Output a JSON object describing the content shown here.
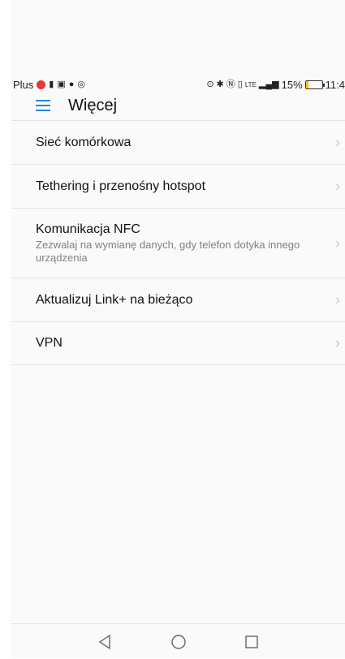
{
  "status_bar": {
    "carrier": "Plus",
    "battery_percent": "15%",
    "battery_level": 0.15,
    "time": "11:4",
    "signal_label": "LTE"
  },
  "header": {
    "title": "Więcej"
  },
  "items": [
    {
      "label": "Sieć komórkowa",
      "sub": ""
    },
    {
      "label": "Tethering i przenośny hotspot",
      "sub": ""
    },
    {
      "label": "Komunikacja NFC",
      "sub": "Zezwalaj na wymianę danych, gdy telefon dotyka innego urządzenia"
    },
    {
      "label": "Aktualizuj Link+ na bieżąco",
      "sub": ""
    },
    {
      "label": "VPN",
      "sub": ""
    }
  ],
  "icons": {
    "menu": "menu-icon",
    "chevron": "chevron-right-icon",
    "back": "back-icon",
    "home": "home-icon",
    "recents": "recents-icon"
  },
  "colors": {
    "accent": "#1e88e5",
    "battery": "#f4c20d",
    "red_icon": "#e53935"
  }
}
